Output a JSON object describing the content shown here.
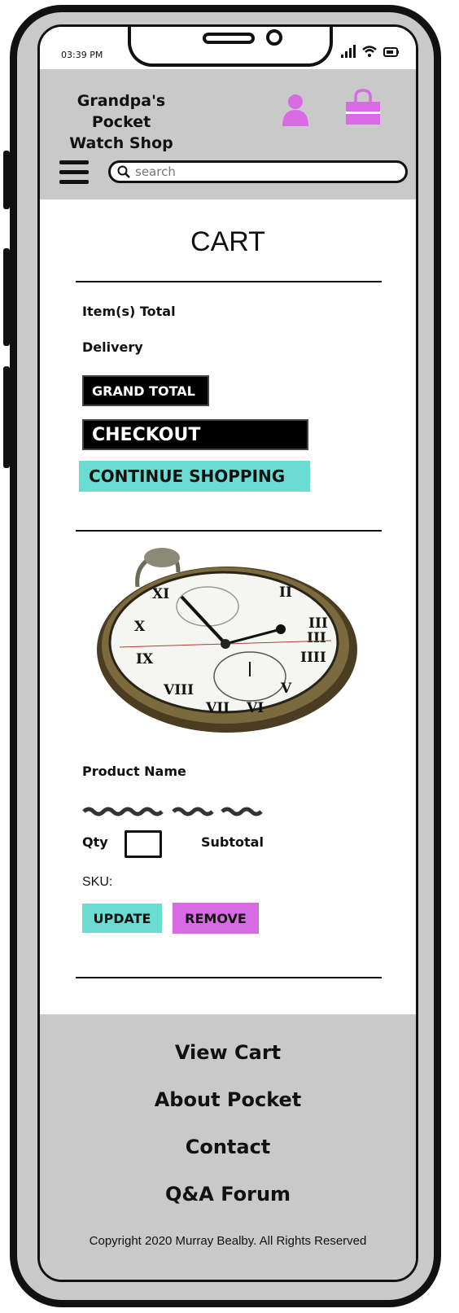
{
  "status_bar": {
    "time": "03:39 PM"
  },
  "header": {
    "shop_name_line1": "Grandpa's Pocket",
    "shop_name_line2": "Watch Shop",
    "accent_color": "#d86be3",
    "header_bg": "#c9c9c9"
  },
  "search": {
    "placeholder": "search"
  },
  "cart": {
    "title": "CART",
    "items_total_label": "Item(s) Total",
    "delivery_label": "Delivery",
    "grand_total_label": "GRAND TOTAL",
    "checkout_label": "CHECKOUT",
    "continue_label": "CONTINUE SHOPPING",
    "teal_color": "#6adcd1"
  },
  "product": {
    "name_label": "Product Name",
    "qty_label": "Qty",
    "subtotal_label": "Subtotal",
    "sku_label": "SKU:",
    "update_label": "UPDATE",
    "remove_label": "REMOVE"
  },
  "footer": {
    "links": [
      "View Cart",
      "About Pocket",
      "Contact",
      "Q&A Forum"
    ],
    "copyright": "Copyright  2020 Murray Bealby. All Rights Reserved"
  }
}
